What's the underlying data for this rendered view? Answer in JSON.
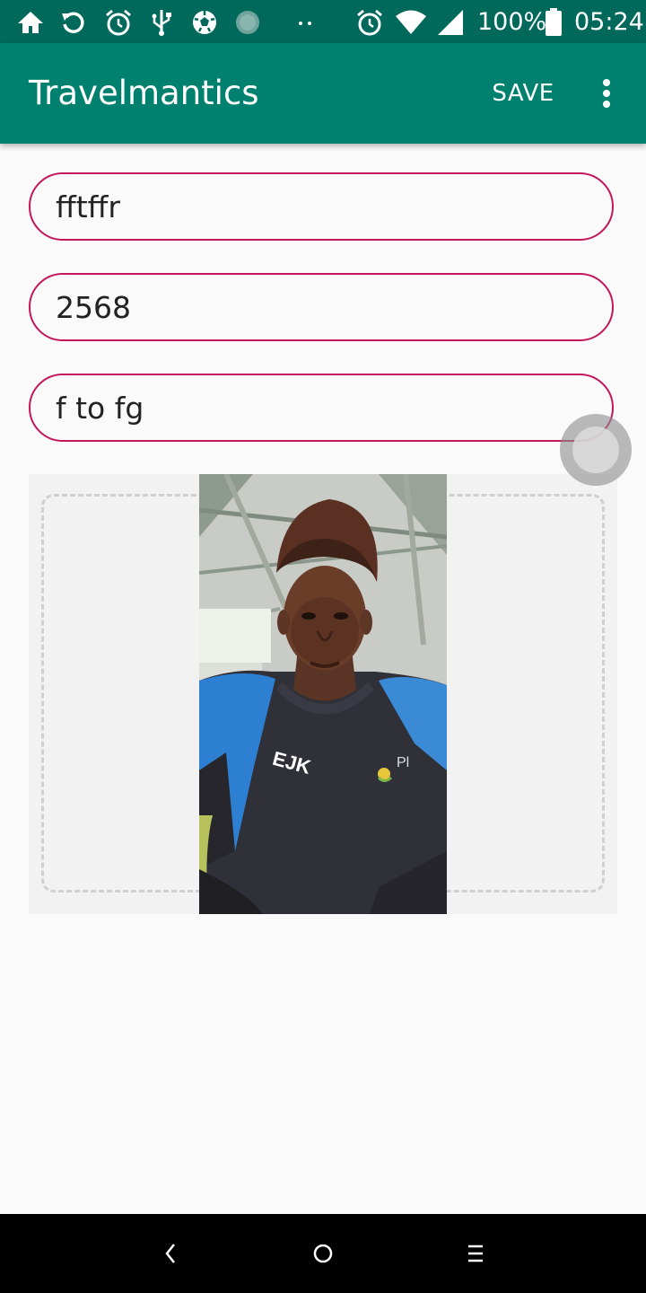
{
  "status_bar": {
    "battery": "100%",
    "time": "05:24",
    "icons": [
      "home-icon",
      "sync-icon",
      "alarm-icon",
      "usb-icon",
      "soccer-ball-icon",
      "spinner-icon",
      "more-dots-icon",
      "alarm-icon",
      "wifi-icon",
      "signal-icon",
      "battery-icon"
    ]
  },
  "app_bar": {
    "title": "Travelmantics",
    "save_label": "SAVE",
    "overflow_icon": "more-vert-icon"
  },
  "form": {
    "title_value": "fftffr",
    "price_value": "2568",
    "description_value": "f to fg"
  },
  "image_section": {
    "photo_icon": "selfie-photo",
    "jersey_letters": "EJK",
    "jersey_text": "Pl"
  },
  "nav_bar": {
    "icons": [
      "back-icon",
      "home-circle-icon",
      "recents-icon"
    ]
  },
  "colors": {
    "status_bar": "#00695c",
    "app_bar": "#00806e",
    "field_border": "#c2185b",
    "background": "#fafafa"
  }
}
